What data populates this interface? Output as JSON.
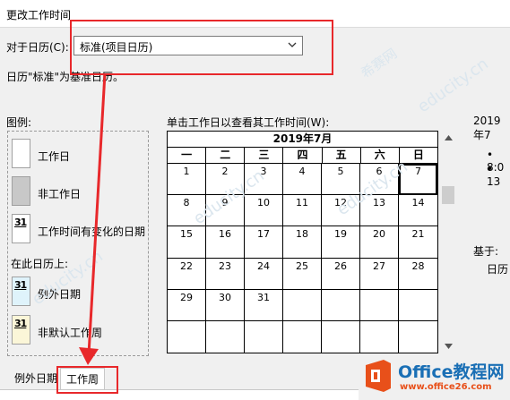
{
  "dialog": {
    "title": "更改工作时间"
  },
  "calendar_select": {
    "label": "对于日历(C):",
    "value": "标准(项目日历)",
    "note": "日历\"标准\"为基准日历。"
  },
  "legend": {
    "title": "图例:",
    "items": [
      {
        "label": "工作日"
      },
      {
        "label": "非工作日"
      },
      {
        "num": "31",
        "label": "工作时间有变化的日期"
      }
    ],
    "subtitle": "在此日历上:",
    "items2": [
      {
        "num": "31",
        "label": "例外日期"
      },
      {
        "num": "31",
        "label": "非默认工作周"
      }
    ]
  },
  "calendar": {
    "prompt": "单击工作日以查看其工作时间(W):",
    "month": "2019年7月",
    "weekdays": [
      "一",
      "二",
      "三",
      "四",
      "五",
      "六",
      "日"
    ],
    "cells": [
      "1",
      "2",
      "3",
      "4",
      "5",
      "6",
      "7",
      "8",
      "9",
      "10",
      "11",
      "12",
      "13",
      "14",
      "15",
      "16",
      "17",
      "18",
      "19",
      "20",
      "21",
      "22",
      "23",
      "24",
      "25",
      "26",
      "27",
      "28",
      "29",
      "30",
      "31",
      "",
      "",
      "",
      "",
      "",
      "",
      "",
      "",
      "",
      "",
      ""
    ],
    "selected_day": "7"
  },
  "right_panel": {
    "heading": "2019年7",
    "bullets": [
      "8:0",
      "13"
    ],
    "base_label": "基于:",
    "base_value": "日历"
  },
  "tabs": [
    {
      "label": "例外日期"
    },
    {
      "label": "工作周"
    }
  ],
  "watermark": {
    "text": "educity.cn",
    "brand": "希赛网"
  },
  "logo": {
    "main": "Office教程网",
    "url": "www.office26.com"
  },
  "colors": {
    "highlight_red": "#e8282b",
    "logo_orange": "#e8501a",
    "logo_blue": "#1a6fb5"
  }
}
